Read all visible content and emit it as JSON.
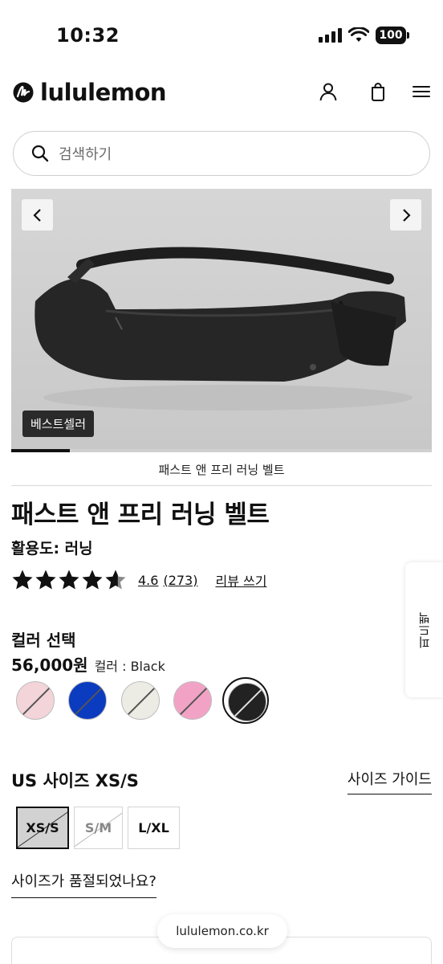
{
  "status_bar": {
    "time": "10:32",
    "battery": "100"
  },
  "header": {
    "brand_name": "lululemon"
  },
  "search": {
    "placeholder": "검색하기"
  },
  "hero": {
    "badge": "베스트셀러",
    "image_progress": 0.14
  },
  "caption": "패스트 앤 프리 러닝 벨트",
  "product": {
    "title": "패스트 앤 프리 러닝 벨트",
    "activity": "활용도: 러닝",
    "rating": "4.6",
    "rating_value": 4.6,
    "review_count": "(273)",
    "write_review": "리뷰 쓰기",
    "side_tab": "피드백"
  },
  "color": {
    "heading": "컬러 선택",
    "price": "56,000원",
    "label": "컬러 : Black",
    "swatches": [
      {
        "name": "light-pink",
        "color": "#f3d4d8",
        "selected": false
      },
      {
        "name": "blue",
        "color": "#0b3bbf",
        "selected": false
      },
      {
        "name": "ivory",
        "color": "#ecebe4",
        "selected": false
      },
      {
        "name": "pink",
        "color": "#f2a3c5",
        "selected": false
      },
      {
        "name": "black",
        "color": "#222222",
        "selected": true
      }
    ]
  },
  "size": {
    "heading": "US 사이즈 XS/S",
    "guide": "사이즈 가이드",
    "options": [
      {
        "label": "XS/S",
        "selected": true,
        "out_of_stock": true
      },
      {
        "label": "S/M",
        "selected": false,
        "out_of_stock": true
      },
      {
        "label": "L/XL",
        "selected": false,
        "out_of_stock": false
      }
    ],
    "soldout_question": "사이즈가 품절되었나요?"
  },
  "browser": {
    "url": "lululemon.co.kr"
  }
}
